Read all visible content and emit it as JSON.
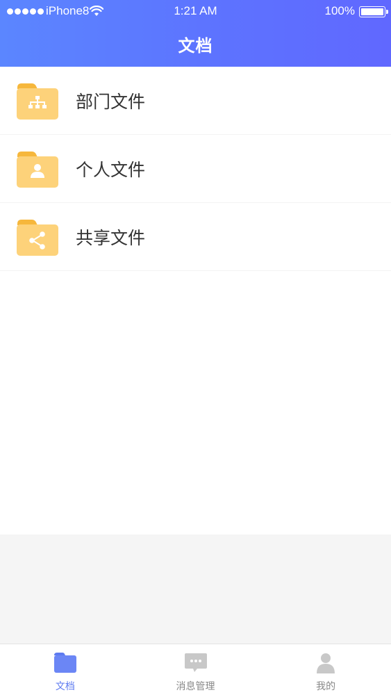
{
  "status_bar": {
    "carrier": "iPhone8",
    "time": "1:21 AM",
    "battery": "100%"
  },
  "header": {
    "title": "文档"
  },
  "folders": [
    {
      "label": "部门文件",
      "icon": "org-chart-icon"
    },
    {
      "label": "个人文件",
      "icon": "person-icon"
    },
    {
      "label": "共享文件",
      "icon": "share-icon"
    }
  ],
  "tabbar": {
    "tabs": [
      {
        "label": "文档",
        "icon": "folder-icon",
        "active": true
      },
      {
        "label": "消息管理",
        "icon": "chat-bubble-icon",
        "active": false
      },
      {
        "label": "我的",
        "icon": "user-icon",
        "active": false
      }
    ]
  },
  "colors": {
    "header_gradient_start": "#5b86ff",
    "header_gradient_end": "#6068ff",
    "folder_body": "#fdd27a",
    "folder_tab": "#f6b73c",
    "tab_active": "#5e7bf0",
    "tab_inactive": "#c8c8c8"
  }
}
